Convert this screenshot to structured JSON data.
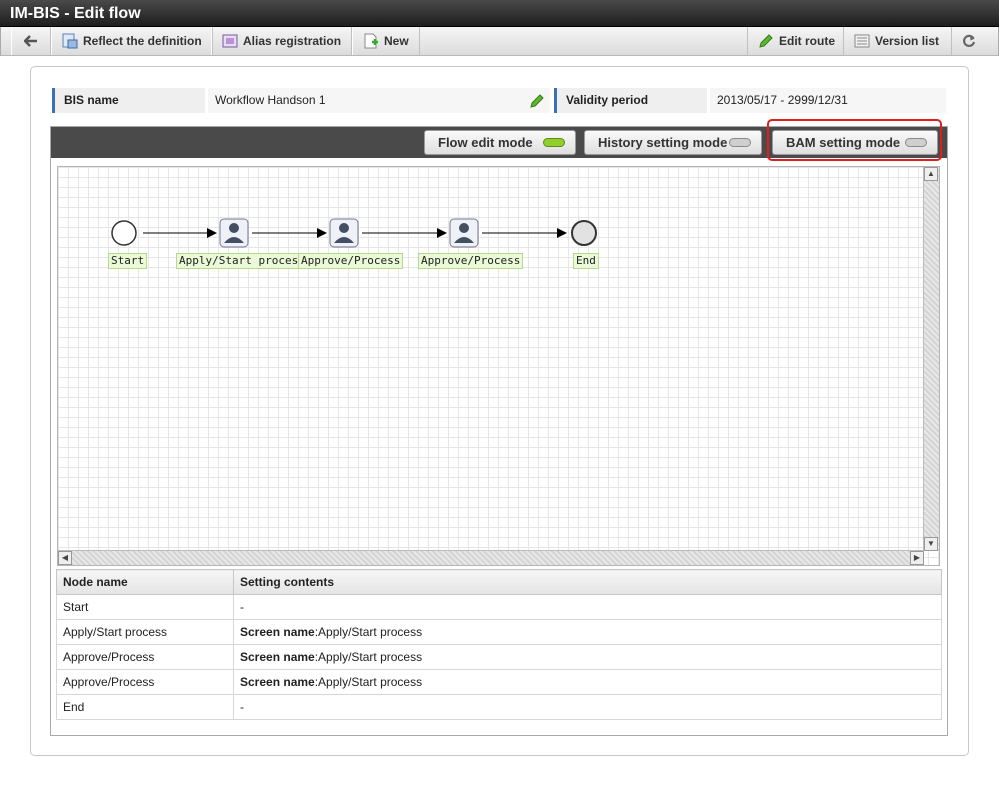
{
  "window": {
    "title": "IM-BIS - Edit flow"
  },
  "toolbar": {
    "reflect_label": "Reflect the definition",
    "alias_label": "Alias registration",
    "new_label": "New",
    "edit_route_label": "Edit route",
    "version_list_label": "Version list"
  },
  "info": {
    "bis_name_label": "BIS name",
    "bis_name_value": "Workflow Handson 1",
    "validity_label": "Validity period",
    "validity_value": "2013/05/17 - 2999/12/31"
  },
  "modes": {
    "flow_edit": "Flow edit mode",
    "history_setting": "History setting mode",
    "bam_setting": "BAM setting mode",
    "active": "flow_edit"
  },
  "flow": {
    "nodes": [
      {
        "label": "Start"
      },
      {
        "label": "Apply/Start process"
      },
      {
        "label": "Approve/Process"
      },
      {
        "label": "Approve/Process"
      },
      {
        "label": "End"
      }
    ]
  },
  "table": {
    "headers": [
      "Node name",
      "Setting contents"
    ],
    "rows": [
      {
        "node": "Start",
        "key": "",
        "value": "-"
      },
      {
        "node": "Apply/Start process",
        "key": "Screen name",
        "value": ":Apply/Start process"
      },
      {
        "node": "Approve/Process",
        "key": "Screen name",
        "value": ":Apply/Start process"
      },
      {
        "node": "Approve/Process",
        "key": "Screen name",
        "value": ":Apply/Start process"
      },
      {
        "node": "End",
        "key": "",
        "value": "-"
      }
    ]
  },
  "colors": {
    "accent": "#3b6fb6",
    "active_led": "#8fd02a",
    "highlight": "#e01e1e",
    "node_label_bg": "#eaf9d6"
  }
}
